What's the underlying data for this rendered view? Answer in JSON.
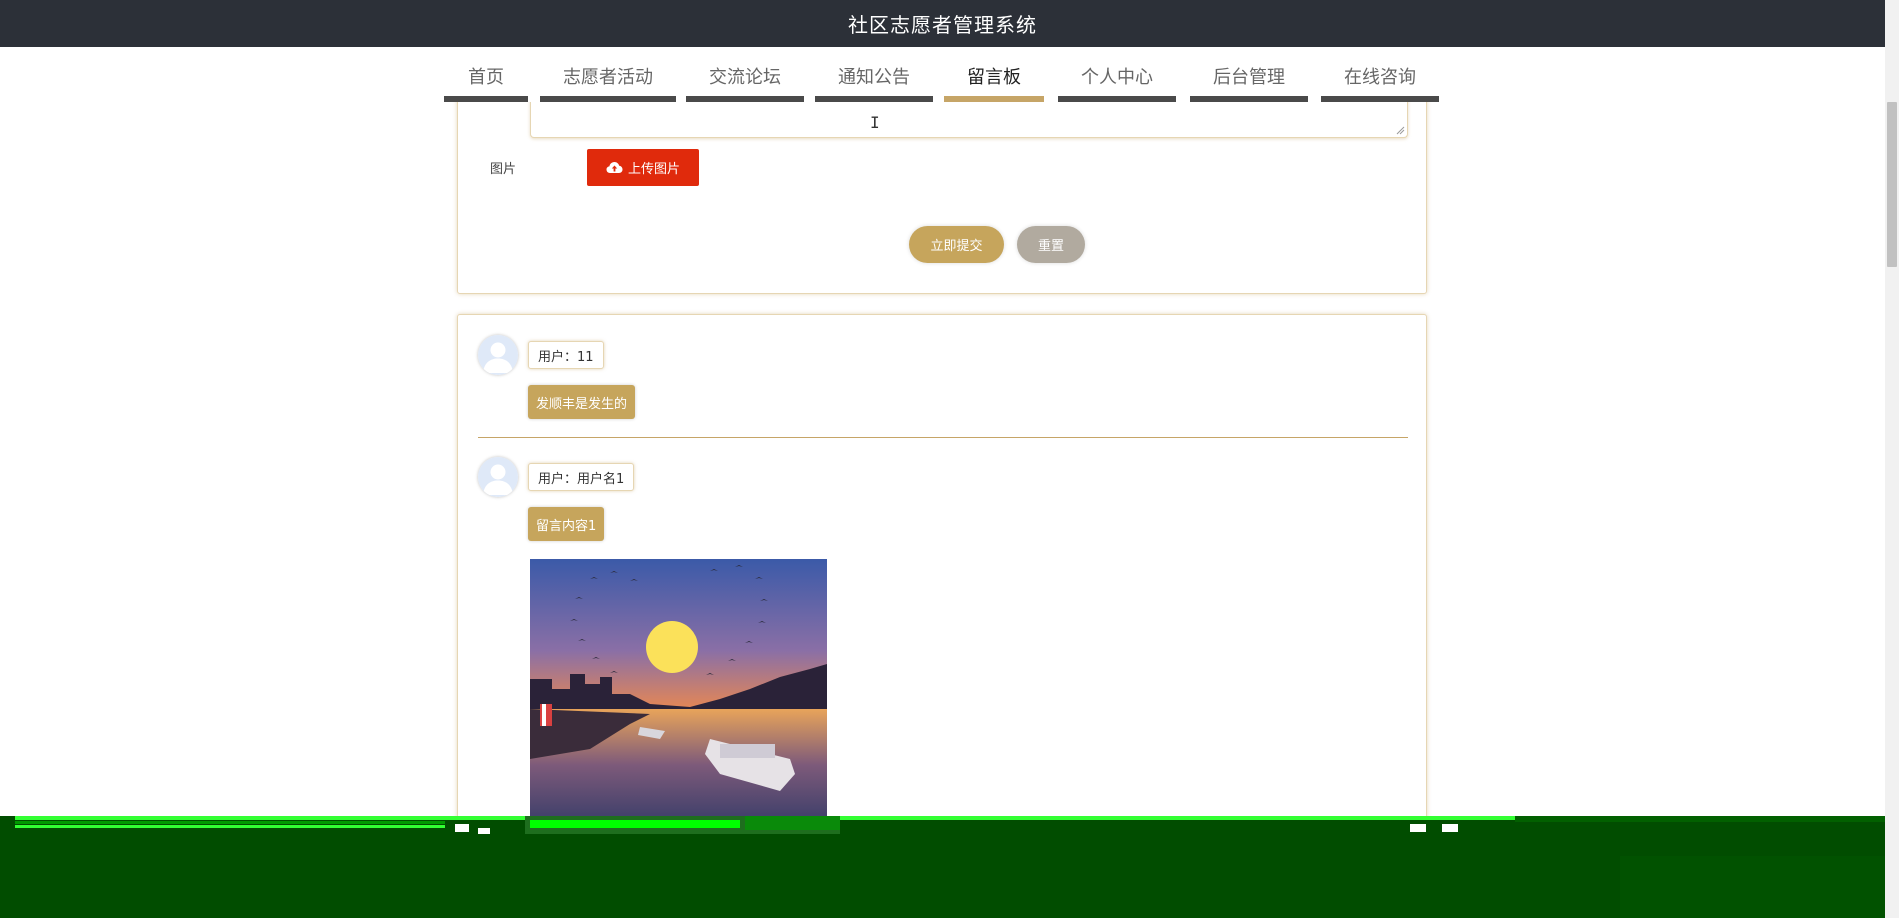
{
  "header": {
    "title": "社区志愿者管理系统"
  },
  "nav": {
    "items": [
      {
        "label": "首页"
      },
      {
        "label": "志愿者活动"
      },
      {
        "label": "交流论坛"
      },
      {
        "label": "通知公告"
      },
      {
        "label": "留言板",
        "active": true
      },
      {
        "label": "个人中心"
      },
      {
        "label": "后台管理"
      },
      {
        "label": "在线咨询"
      }
    ]
  },
  "form": {
    "image_label": "图片",
    "upload_label": "上传图片",
    "submit_label": "立即提交",
    "reset_label": "重置"
  },
  "messages": [
    {
      "user": "用户：11",
      "content": "发顺丰是发生的"
    },
    {
      "user": "用户：用户名1",
      "content": "留言内容1"
    }
  ],
  "colors": {
    "accent": "#c6a55c",
    "upload": "#e02a0c",
    "reset": "#b1aa9f",
    "header": "#2c3038",
    "glitch": "#014d00"
  }
}
